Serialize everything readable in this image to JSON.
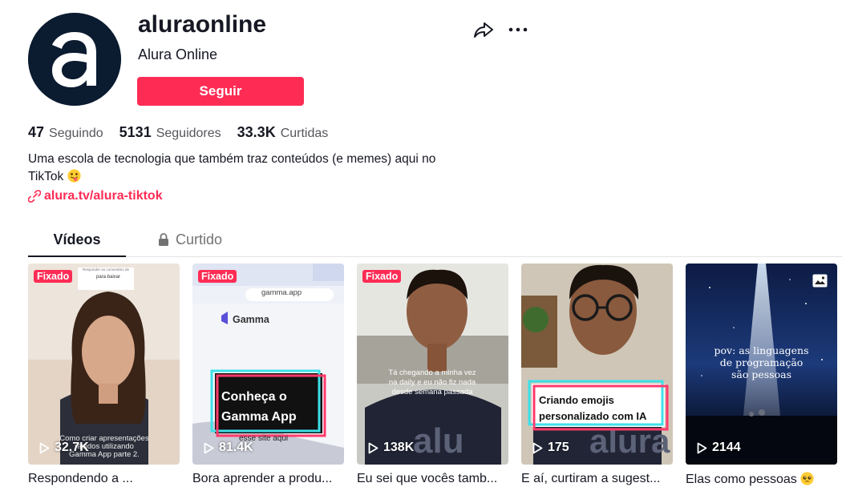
{
  "profile": {
    "username": "aluraonline",
    "nickname": "Alura Online",
    "follow_label": "Seguir",
    "avatar_letter": "a",
    "bio_text": "Uma escola de tecnologia que também traz conteúdos (e memes) aqui no TikTok",
    "link": "alura.tv/alura-tiktok"
  },
  "stats": [
    {
      "value": "47",
      "label": "Seguindo"
    },
    {
      "value": "5131",
      "label": "Seguidores"
    },
    {
      "value": "33.3K",
      "label": "Curtidas"
    }
  ],
  "tabs": {
    "videos": "Vídeos",
    "liked": "Curtido"
  },
  "videos": [
    {
      "pinned": "Fixado",
      "plays": "32.7K",
      "caption": "Respondendo a ...",
      "overlay_top": "Responder ao comentário de",
      "overlay_mid": "para baixar",
      "overlay_bottom_1": "Como criar apresentações",
      "overlay_bottom_2": "rápidos utilizando",
      "overlay_bottom_3": "Gamma App parte 2."
    },
    {
      "pinned": "Fixado",
      "plays": "81.4K",
      "caption": "Bora aprender a produ...",
      "url_text": "gamma.app",
      "brand": "Gamma",
      "card_line1": "Conheça o",
      "card_line2": "Gamma App",
      "under_text": "esse site aqui"
    },
    {
      "pinned": "Fixado",
      "plays": "138K",
      "caption": "Eu sei que vocês tamb...",
      "line1": "Tá chegando a minha vez",
      "line2": "na daily e eu não fiz nada",
      "line3": "desde semana passada"
    },
    {
      "pinned": "",
      "plays": "175",
      "caption": "E aí, curtiram a sugest...",
      "label1": "Criando emojis",
      "label2": "personalizado com IA"
    },
    {
      "pinned": "",
      "plays": "2144",
      "caption": "Elas como pessoas",
      "text1": "pov: as linguagens",
      "text2": "de programação",
      "text3": "são pessoas"
    }
  ],
  "colors": {
    "accent": "#fe2c55",
    "text": "#161823",
    "muted": "#55565c"
  }
}
